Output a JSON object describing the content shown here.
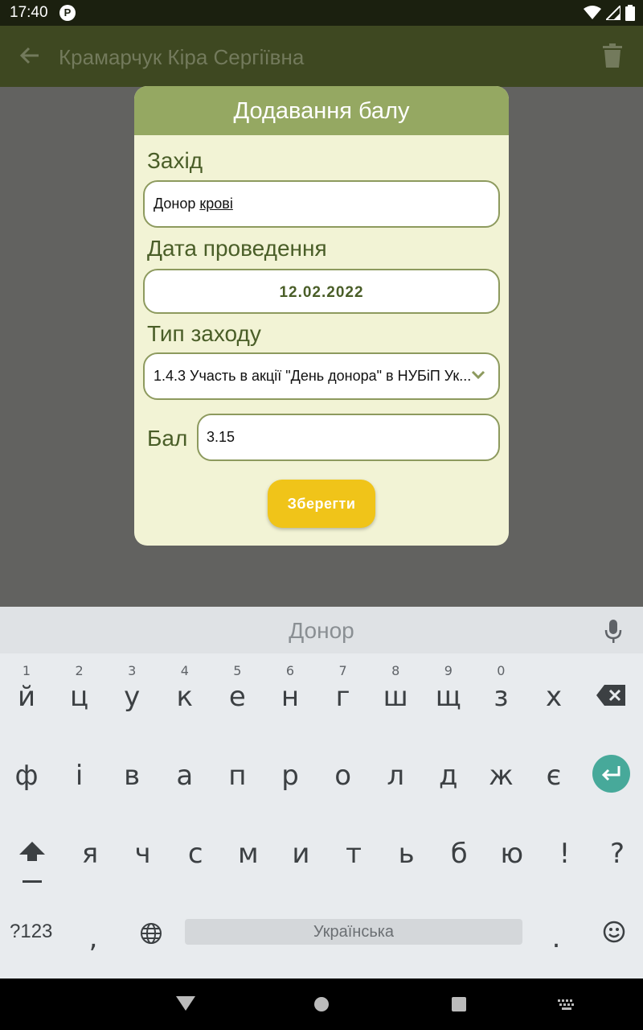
{
  "status": {
    "time": "17:40",
    "app_badge": "P"
  },
  "appbar": {
    "title": "Крамарчук Кіра Сергіївна"
  },
  "dialog": {
    "title": "Додавання балу",
    "event_label": "Захід",
    "event_value_plain": "Донор ",
    "event_value_underlined": "крові",
    "date_label": "Дата проведення",
    "date_value": "12.02.2022",
    "type_label": "Тип заходу",
    "type_value": "1.4.3 Участь в акції \"День донора\" в НУБіП Ук...",
    "score_label": "Бал",
    "score_value": "3.15",
    "save_label": "Зберегти"
  },
  "keyboard": {
    "suggestion": "Донор",
    "row1": [
      "й",
      "ц",
      "у",
      "к",
      "е",
      "н",
      "г",
      "ш",
      "щ",
      "з",
      "х"
    ],
    "row1_hints": [
      "1",
      "2",
      "3",
      "4",
      "5",
      "6",
      "7",
      "8",
      "9",
      "0",
      ""
    ],
    "row2": [
      "ф",
      "і",
      "в",
      "а",
      "п",
      "р",
      "о",
      "л",
      "д",
      "ж",
      "є"
    ],
    "row3": [
      "я",
      "ч",
      "с",
      "м",
      "и",
      "т",
      "ь",
      "б",
      "ю",
      "!",
      "?"
    ],
    "sym_label": "?123",
    "comma": ",",
    "space_label": "Українська",
    "period": "."
  },
  "colors": {
    "appbar": "#3e4821",
    "dialog_header": "#95a862",
    "dialog_bg": "#f2f3d5",
    "accent_text": "#4a5e28",
    "save_button": "#f0c419",
    "enter_key": "#47a99a"
  }
}
